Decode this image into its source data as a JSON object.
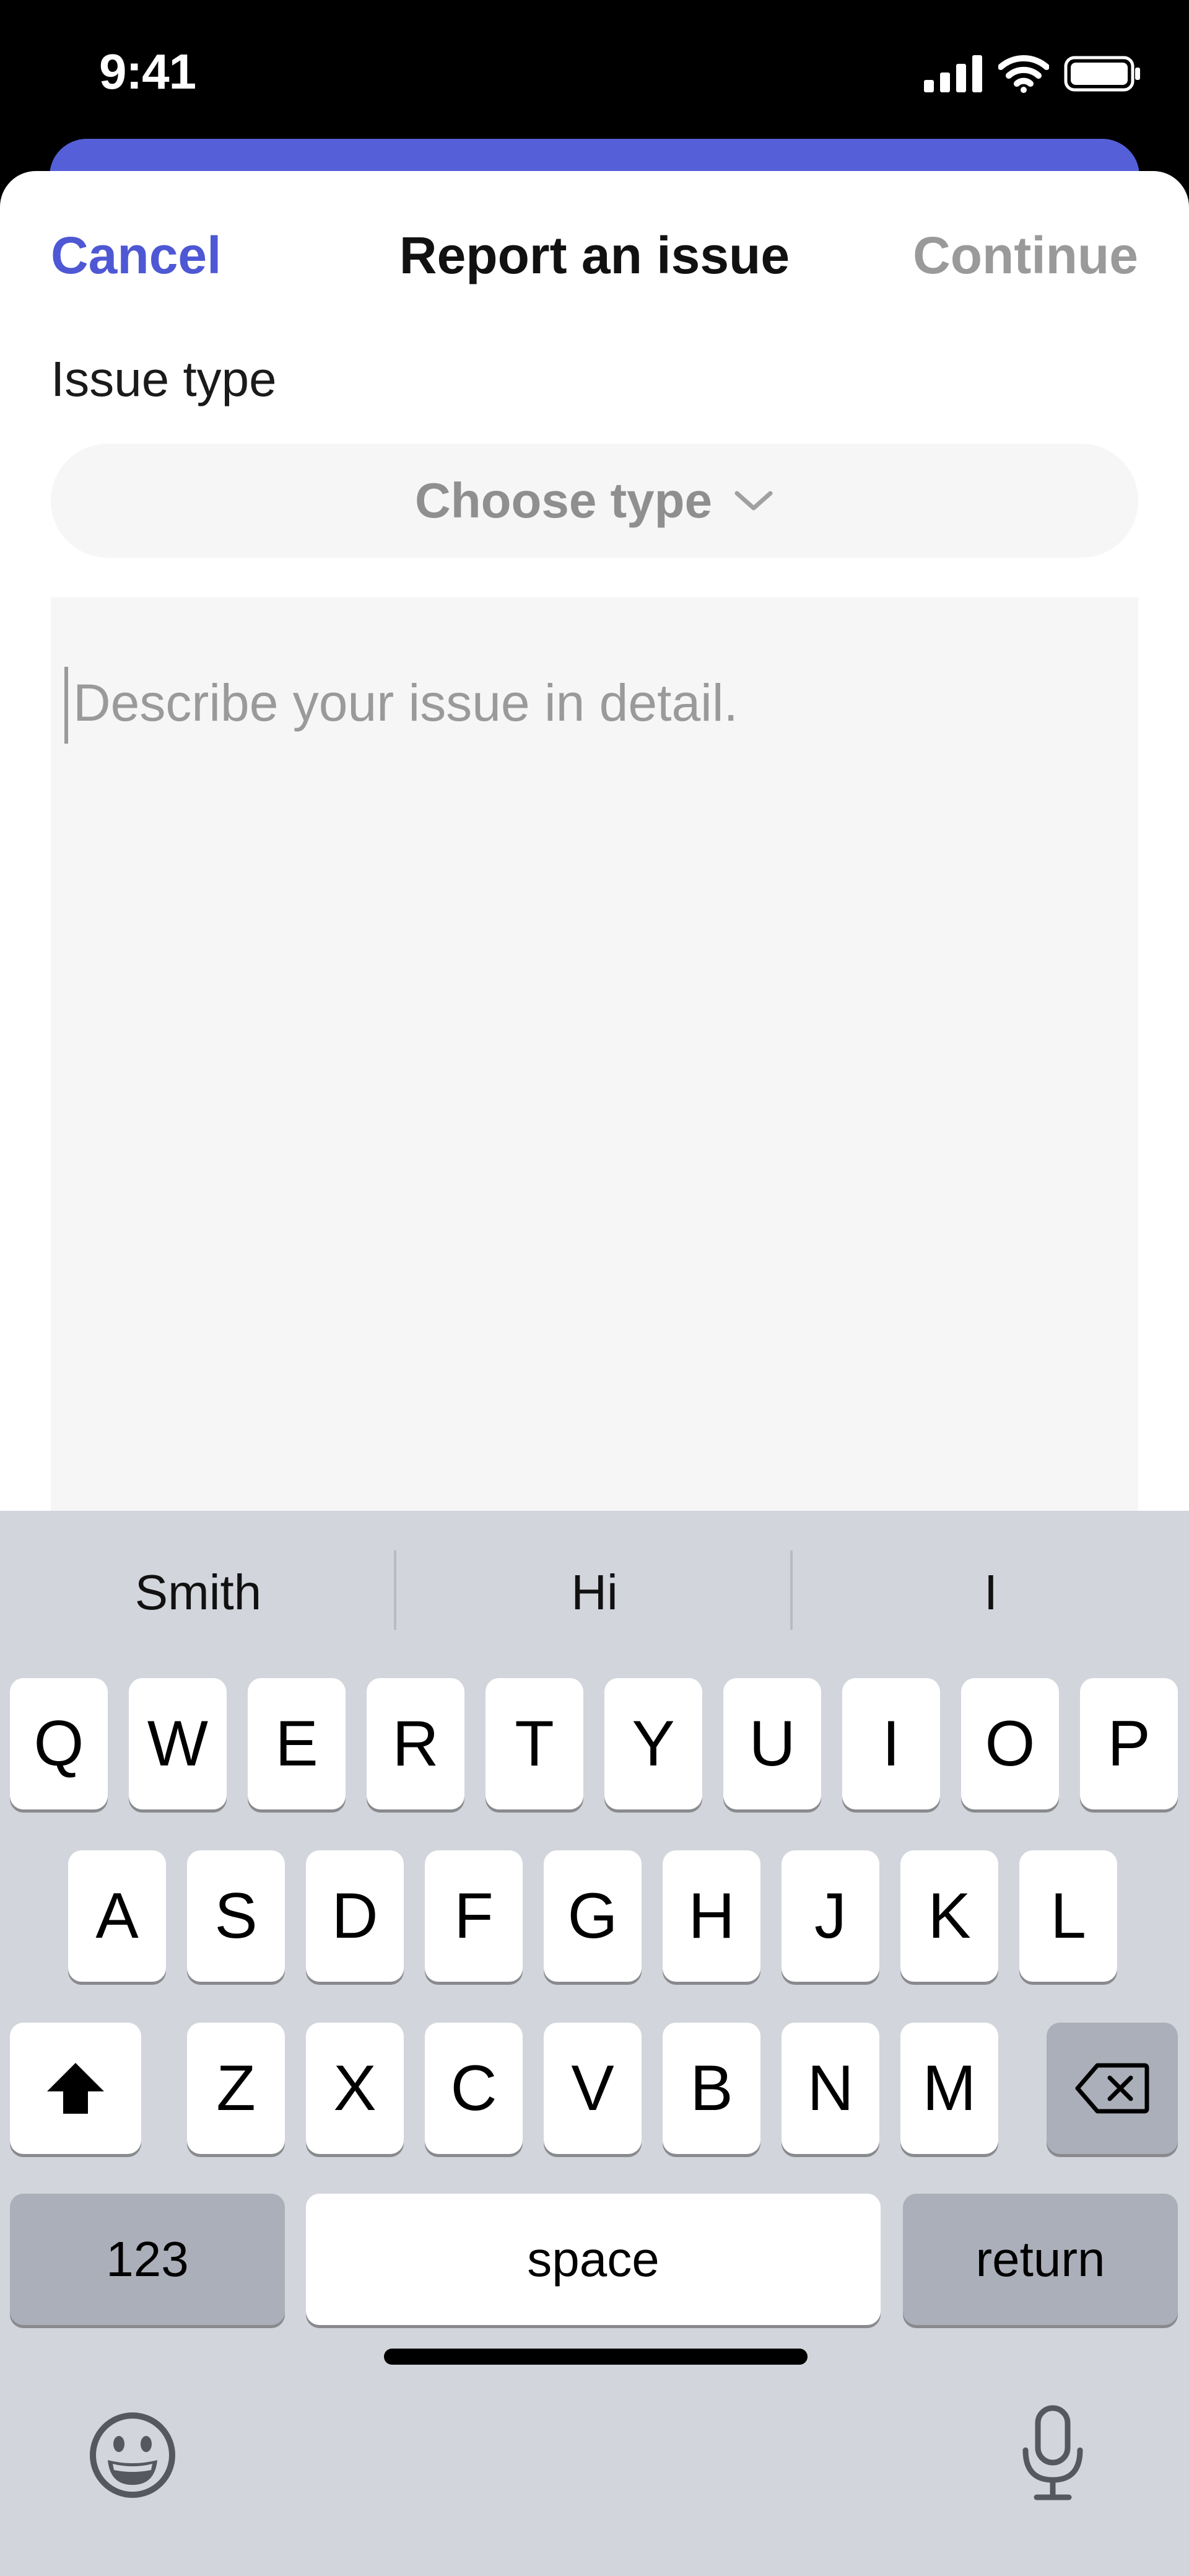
{
  "status_bar": {
    "time": "9:41"
  },
  "nav": {
    "cancel": "Cancel",
    "title": "Report an issue",
    "continue": "Continue"
  },
  "form": {
    "issue_type_label": "Issue type",
    "type_select_placeholder": "Choose type",
    "description_placeholder": "Describe your issue in detail."
  },
  "keyboard": {
    "suggestions": [
      "Smith",
      "Hi",
      "I"
    ],
    "row1": [
      "Q",
      "W",
      "E",
      "R",
      "T",
      "Y",
      "U",
      "I",
      "O",
      "P"
    ],
    "row2": [
      "A",
      "S",
      "D",
      "F",
      "G",
      "H",
      "J",
      "K",
      "L"
    ],
    "row3": [
      "Z",
      "X",
      "C",
      "V",
      "B",
      "N",
      "M"
    ],
    "numbers_key": "123",
    "space_key": "space",
    "return_key": "return"
  },
  "colors": {
    "accent": "#4E58D4",
    "sheet_underlay": "#5560D8",
    "muted_text": "#9A9A9A",
    "keyboard_bg": "#D2D5DB"
  }
}
